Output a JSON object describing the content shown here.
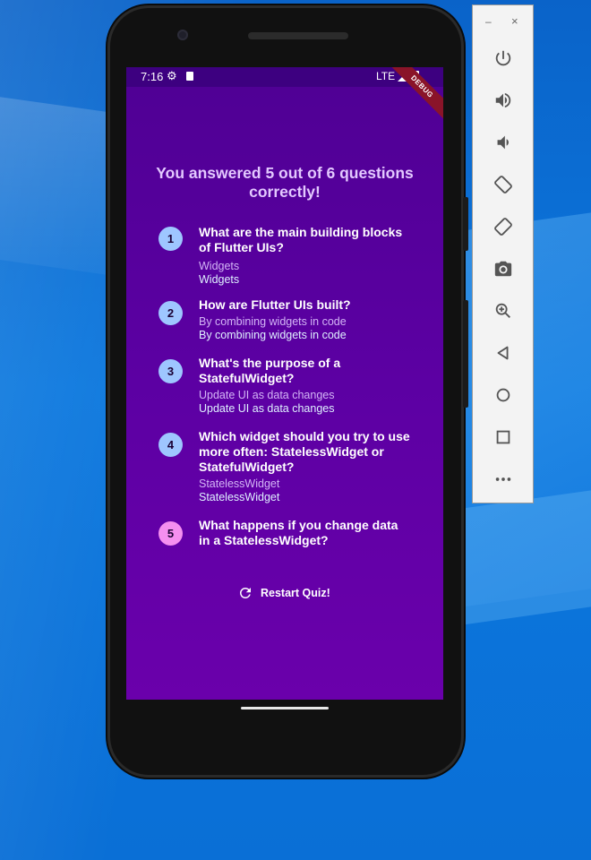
{
  "status_bar": {
    "time": "7:16",
    "network": "LTE"
  },
  "debug_banner": "DEBUG",
  "result": {
    "title": "You answered 5 out of 6 questions correctly!"
  },
  "questions": [
    {
      "number": "1",
      "question": "What are the main building blocks of Flutter UIs?",
      "user_answer": "Widgets",
      "correct_answer": "Widgets",
      "badge_color": "#9ec6ff"
    },
    {
      "number": "2",
      "question": "How are Flutter UIs built?",
      "user_answer": "By combining widgets in code",
      "correct_answer": "By combining widgets in code",
      "badge_color": "#9ec6ff"
    },
    {
      "number": "3",
      "question": "What's the purpose of a StatefulWidget?",
      "user_answer": "Update UI as data changes",
      "correct_answer": "Update UI as data changes",
      "badge_color": "#9ec6ff"
    },
    {
      "number": "4",
      "question": "Which widget should you try to use more often: StatelessWidget or StatefulWidget?",
      "user_answer": "StatelessWidget",
      "correct_answer": "StatelessWidget",
      "badge_color": "#9ec6ff"
    },
    {
      "number": "5",
      "question": "What happens if you change data in a StatelessWidget?",
      "user_answer": "",
      "correct_answer": "",
      "badge_color": "#f58ff0"
    }
  ],
  "restart": {
    "label": "Restart Quiz!",
    "icon": "refresh-icon"
  },
  "emulator_toolbar": {
    "minimize": "–",
    "close": "×",
    "buttons": [
      "power-icon",
      "volume-up-icon",
      "volume-down-icon",
      "rotate-left-icon",
      "rotate-right-icon",
      "camera-icon",
      "zoom-icon",
      "back-icon",
      "home-icon",
      "overview-icon",
      "more-icon"
    ]
  },
  "colors": {
    "screen_top": "#4f0094",
    "screen_bottom": "#6a00ab",
    "title": "#e3c8ff",
    "correct_badge": "#9ec6ff",
    "wrong_badge": "#f58ff0"
  }
}
